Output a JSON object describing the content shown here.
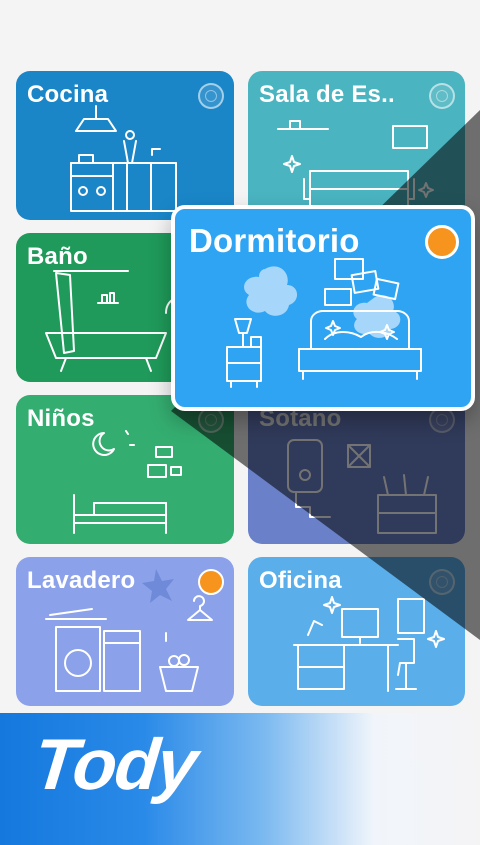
{
  "rooms": {
    "cocina": {
      "label": "Cocina",
      "status": "unchecked"
    },
    "sala": {
      "label": "Sala de Es..",
      "status": "unchecked"
    },
    "bano": {
      "label": "Baño",
      "status": "unchecked"
    },
    "dormitorio": {
      "label": "Dormitorio",
      "status": "selected"
    },
    "ninos": {
      "label": "Niños",
      "status": "unchecked"
    },
    "sotano": {
      "label": "Sotano",
      "status": "unchecked"
    },
    "lavadero": {
      "label": "Lavadero",
      "status": "selected"
    },
    "oficina": {
      "label": "Oficina",
      "status": "unchecked"
    }
  },
  "brand": {
    "name": "Tody"
  },
  "colors": {
    "cocina": "#1a86c8",
    "sala": "#4ab4c0",
    "bano": "#1f9a5a",
    "dormitorio": "#2ea4f3",
    "ninos": "#34ad70",
    "sotano": "#6a80c8",
    "lavadero": "#8ba1ea",
    "oficina": "#5aaeea",
    "selected_indicator": "#f7941d",
    "brand": "#1478dd"
  }
}
